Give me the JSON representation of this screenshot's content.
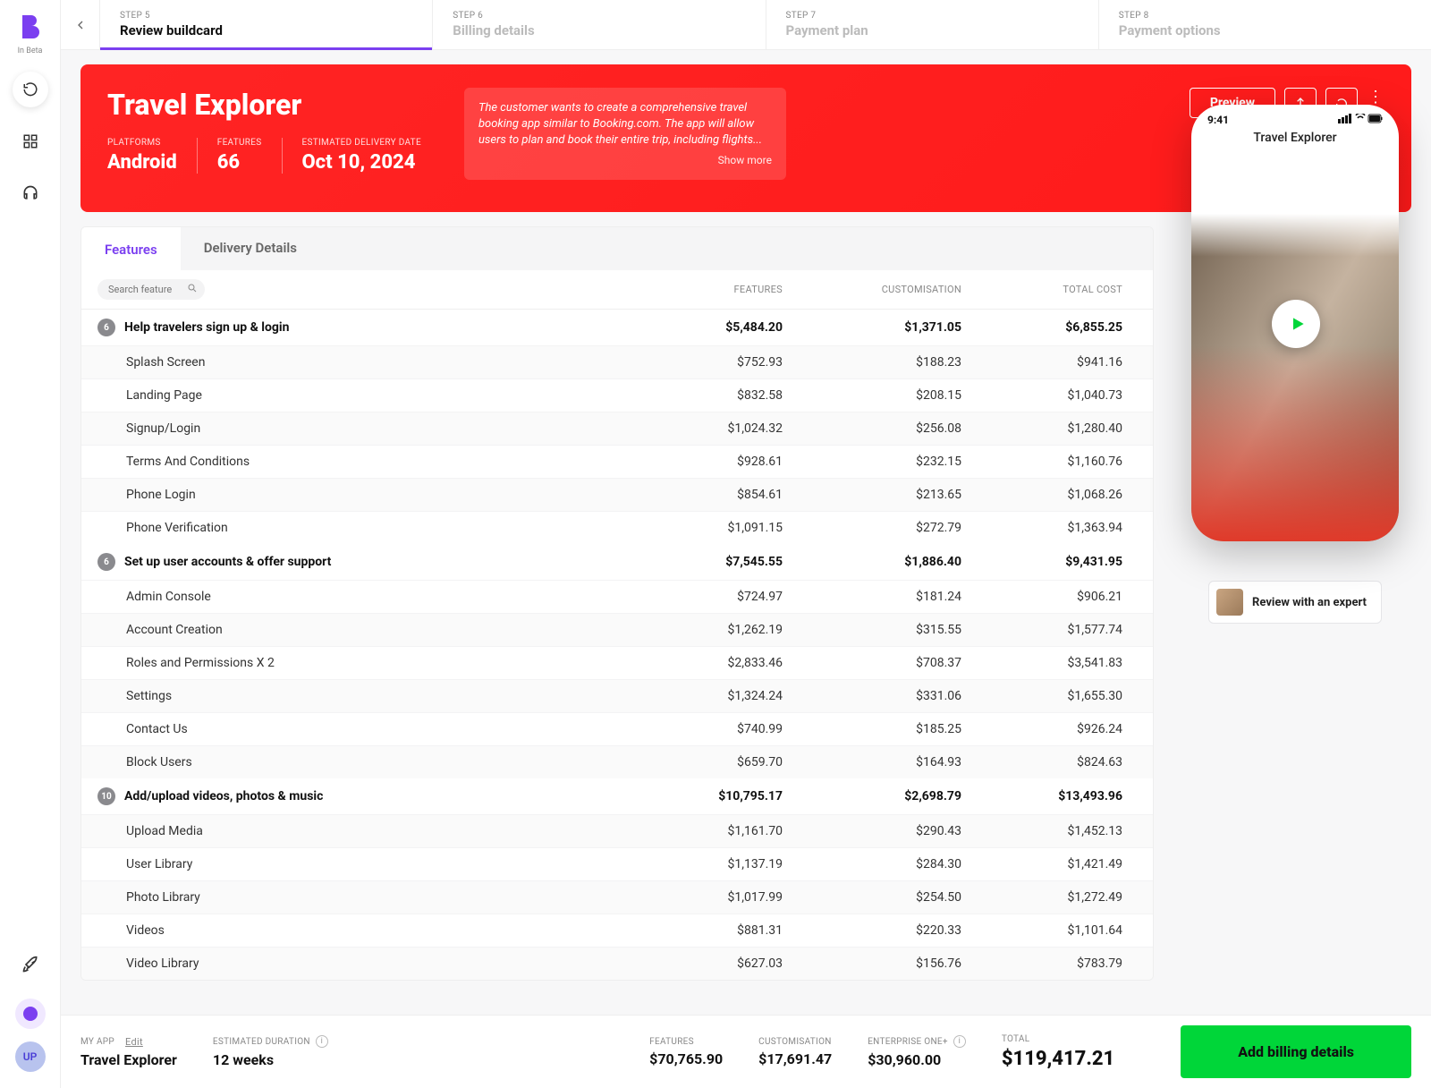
{
  "sidebar": {
    "beta": "In Beta",
    "avatar_initials": "UP"
  },
  "steps": [
    {
      "num": "STEP 5",
      "title": "Review buildcard",
      "active": true
    },
    {
      "num": "STEP 6",
      "title": "Billing details",
      "active": false
    },
    {
      "num": "STEP 7",
      "title": "Payment plan",
      "active": false
    },
    {
      "num": "STEP 8",
      "title": "Payment options",
      "active": false
    }
  ],
  "hero": {
    "title": "Travel Explorer",
    "platforms_label": "PLATFORMS",
    "platforms": "Android",
    "features_label": "FEATURES",
    "features": "66",
    "delivery_label": "ESTIMATED DELIVERY DATE",
    "delivery": "Oct 10, 2024",
    "desc": "The customer wants to create a comprehensive travel booking app similar to Booking.com. The app will allow users to plan and book their entire trip, including flights...",
    "show_more": "Show more",
    "preview": "Preview"
  },
  "tabs": {
    "features": "Features",
    "delivery": "Delivery Details"
  },
  "table": {
    "search_placeholder": "Search feature",
    "headers": {
      "features": "FEATURES",
      "customisation": "CUSTOMISATION",
      "total": "TOTAL COST"
    },
    "groups": [
      {
        "count": "6",
        "name": "Help travelers sign up & login",
        "feat": "$5,484.20",
        "cust": "$1,371.05",
        "total": "$6,855.25",
        "rows": [
          {
            "name": "Splash Screen",
            "feat": "$752.93",
            "cust": "$188.23",
            "total": "$941.16"
          },
          {
            "name": "Landing Page",
            "feat": "$832.58",
            "cust": "$208.15",
            "total": "$1,040.73"
          },
          {
            "name": "Signup/Login",
            "feat": "$1,024.32",
            "cust": "$256.08",
            "total": "$1,280.40"
          },
          {
            "name": "Terms And Conditions",
            "feat": "$928.61",
            "cust": "$232.15",
            "total": "$1,160.76"
          },
          {
            "name": "Phone Login",
            "feat": "$854.61",
            "cust": "$213.65",
            "total": "$1,068.26"
          },
          {
            "name": "Phone Verification",
            "feat": "$1,091.15",
            "cust": "$272.79",
            "total": "$1,363.94"
          }
        ]
      },
      {
        "count": "6",
        "name": "Set up user accounts & offer support",
        "feat": "$7,545.55",
        "cust": "$1,886.40",
        "total": "$9,431.95",
        "rows": [
          {
            "name": "Admin Console",
            "feat": "$724.97",
            "cust": "$181.24",
            "total": "$906.21"
          },
          {
            "name": "Account Creation",
            "feat": "$1,262.19",
            "cust": "$315.55",
            "total": "$1,577.74"
          },
          {
            "name": "Roles and Permissions X 2",
            "feat": "$2,833.46",
            "cust": "$708.37",
            "total": "$3,541.83"
          },
          {
            "name": "Settings",
            "feat": "$1,324.24",
            "cust": "$331.06",
            "total": "$1,655.30"
          },
          {
            "name": "Contact Us",
            "feat": "$740.99",
            "cust": "$185.25",
            "total": "$926.24"
          },
          {
            "name": "Block Users",
            "feat": "$659.70",
            "cust": "$164.93",
            "total": "$824.63"
          }
        ]
      },
      {
        "count": "10",
        "name": "Add/upload videos, photos & music",
        "feat": "$10,795.17",
        "cust": "$2,698.79",
        "total": "$13,493.96",
        "rows": [
          {
            "name": "Upload Media",
            "feat": "$1,161.70",
            "cust": "$290.43",
            "total": "$1,452.13"
          },
          {
            "name": "User Library",
            "feat": "$1,137.19",
            "cust": "$284.30",
            "total": "$1,421.49"
          },
          {
            "name": "Photo Library",
            "feat": "$1,017.99",
            "cust": "$254.50",
            "total": "$1,272.49"
          },
          {
            "name": "Videos",
            "feat": "$881.31",
            "cust": "$220.33",
            "total": "$1,101.64"
          },
          {
            "name": "Video Library",
            "feat": "$627.03",
            "cust": "$156.76",
            "total": "$783.79"
          }
        ]
      }
    ]
  },
  "phone": {
    "time": "9:41",
    "title": "Travel Explorer"
  },
  "expert": "Review with an expert",
  "footer": {
    "myapp_label": "MY APP",
    "edit": "Edit",
    "myapp": "Travel Explorer",
    "duration_label": "ESTIMATED DURATION",
    "duration": "12 weeks",
    "features_label": "FEATURES",
    "features": "$70,765.90",
    "cust_label": "CUSTOMISATION",
    "cust": "$17,691.47",
    "ent_label": "ENTERPRISE ONE+",
    "ent": "$30,960.00",
    "total_label": "TOTAL",
    "total": "$119,417.21",
    "cta": "Add billing details"
  }
}
